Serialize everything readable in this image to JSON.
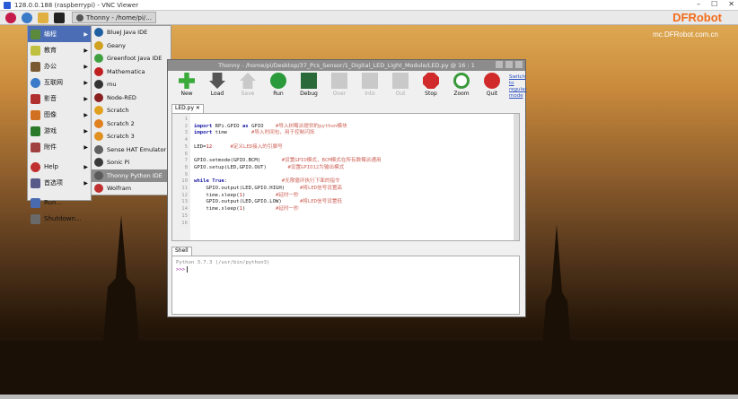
{
  "vnc": {
    "title": "128.0.0.188 (raspberrypi) - VNC Viewer",
    "controls": [
      "–",
      "☐",
      "✕"
    ]
  },
  "taskbar": {
    "task_label": "Thonny - /home/pi/..."
  },
  "brand": {
    "logo": "DFRobot",
    "url": "mc.DFRobot.com.cn"
  },
  "menu": {
    "items": [
      {
        "label": "编程",
        "icon": "code-icon",
        "color": "#5a8a3a",
        "has_arrow": true,
        "selected": true
      },
      {
        "label": "教育",
        "icon": "education-icon",
        "color": "#c0c040",
        "has_arrow": true
      },
      {
        "label": "办公",
        "icon": "office-icon",
        "color": "#7a5a30",
        "has_arrow": true
      },
      {
        "label": "互联网",
        "icon": "globe-icon",
        "color": "#3a7ac8",
        "has_arrow": true
      },
      {
        "label": "影音",
        "icon": "media-icon",
        "color": "#b03030",
        "has_arrow": true
      },
      {
        "label": "图像",
        "icon": "graphics-icon",
        "color": "#d07020",
        "has_arrow": true
      },
      {
        "label": "游戏",
        "icon": "games-icon",
        "color": "#2a7a2a",
        "has_arrow": true
      },
      {
        "label": "附件",
        "icon": "accessories-icon",
        "color": "#a04040",
        "has_arrow": true
      },
      {
        "label": "Help",
        "icon": "help-icon",
        "color": "#c03030",
        "has_arrow": true
      },
      {
        "label": "首选项",
        "icon": "preferences-icon",
        "color": "#5a5a8a",
        "has_arrow": true
      },
      {
        "label": "Run...",
        "icon": "run-icon",
        "color": "#4a6ab0",
        "has_arrow": false
      },
      {
        "label": "Shutdown...",
        "icon": "shutdown-icon",
        "color": "#6a6a6a",
        "has_arrow": false
      }
    ]
  },
  "submenu": {
    "items": [
      {
        "label": "BlueJ Java IDE",
        "color": "#2060a0"
      },
      {
        "label": "Geany",
        "color": "#d0a020"
      },
      {
        "label": "Greenfoot Java IDE",
        "color": "#40a040"
      },
      {
        "label": "Mathematica",
        "color": "#c02020"
      },
      {
        "label": "mu",
        "color": "#333333"
      },
      {
        "label": "Node-RED",
        "color": "#8a2020"
      },
      {
        "label": "Scratch",
        "color": "#e0a020"
      },
      {
        "label": "Scratch 2",
        "color": "#e08020"
      },
      {
        "label": "Scratch 3",
        "color": "#e09020"
      },
      {
        "label": "Sense HAT Emulator",
        "color": "#606060"
      },
      {
        "label": "Sonic Pi",
        "color": "#3a3a3a"
      },
      {
        "label": "Thonny Python IDE",
        "color": "#5a5a5a",
        "selected": true
      },
      {
        "label": "Wolfram",
        "color": "#c03030"
      }
    ]
  },
  "thonny": {
    "title": "Thonny  -  /home/pi/Desktop/37_Pcs_Sensor/1_Digital_LED_Light_Module/LED.py  @  16 : 1",
    "tools": [
      {
        "label": "New",
        "icon": "new-icon",
        "color": "#3aaa3a",
        "enabled": true
      },
      {
        "label": "Load",
        "icon": "load-icon",
        "color": "#555555",
        "enabled": true
      },
      {
        "label": "Save",
        "icon": "save-icon",
        "color": "#c9c9c9",
        "enabled": false
      },
      {
        "label": "Run",
        "icon": "run-icon",
        "color": "#2a9a3a",
        "enabled": true
      },
      {
        "label": "Debug",
        "icon": "debug-icon",
        "color": "#2a6a3a",
        "enabled": true
      },
      {
        "label": "Over",
        "icon": "step-over-icon",
        "color": "#c9c9c9",
        "enabled": false
      },
      {
        "label": "Into",
        "icon": "step-into-icon",
        "color": "#c9c9c9",
        "enabled": false
      },
      {
        "label": "Out",
        "icon": "step-out-icon",
        "color": "#c9c9c9",
        "enabled": false
      },
      {
        "label": "Stop",
        "icon": "stop-icon",
        "color": "#d02a2a",
        "enabled": true
      },
      {
        "label": "Zoom",
        "icon": "zoom-icon",
        "color": "#3a9a3a",
        "enabled": true
      },
      {
        "label": "Quit",
        "icon": "quit-icon",
        "color": "#d02a2a",
        "enabled": true
      }
    ],
    "switch_link": "Switch to regular mode",
    "editor_tab": "LED.py ✕",
    "line_numbers": [
      "1",
      "2",
      "3",
      "4",
      "5",
      "6",
      "7",
      "8",
      "9",
      "10",
      "11",
      "12",
      "13",
      "14",
      "15",
      "16"
    ],
    "code": [
      "",
      "import RPi.GPIO as GPIO    #导入树莓派提供的python模块",
      "import time        #导入时间包，用于控制闪烁",
      "",
      "LED=12      #定义LED接入的引脚号",
      "",
      "GPIO.setmode(GPIO.BCM)       #设置GPIO模式，BCM模式在所有数莓派通用",
      "GPIO.setup(LED,GPIO.OUT)       #设置GPIO12为输出模式",
      "",
      "while True:                  #无限循环执行下面的指令",
      "    GPIO.output(LED,GPIO.HIGH)     #将LED信号设置高",
      "    time.sleep(1)          #延时一秒",
      "    GPIO.output(LED,GPIO.LOW)      #将LED信号设置低",
      "    time.sleep(1)          #延时一秒",
      "",
      ""
    ],
    "shell_tab": "Shell",
    "shell_banner": "Python 3.7.3 (/usr/bin/python3)",
    "shell_prompt": ">>>"
  }
}
